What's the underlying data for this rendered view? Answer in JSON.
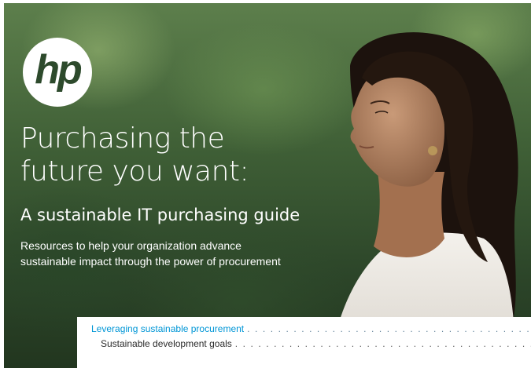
{
  "brand": {
    "logo_text": "hp"
  },
  "hero": {
    "title_line1": "Purchasing the",
    "title_line2": "future you want:",
    "subtitle": "A sustainable IT purchasing guide",
    "description_line1": "Resources to help your organization advance",
    "description_line2": "sustainable impact through the power of procurement"
  },
  "toc": {
    "items": [
      {
        "label": "Leveraging sustainable procurement",
        "color": "#0096d6"
      },
      {
        "label": "Sustainable development goals",
        "color": "#2b2b2b"
      }
    ],
    "leader": ". . . . . . . . . . . . . . . . . . . . . . . . . . . . . . . . . . . . . . . . . . . . . . . . . . . . . . . . . . ."
  }
}
